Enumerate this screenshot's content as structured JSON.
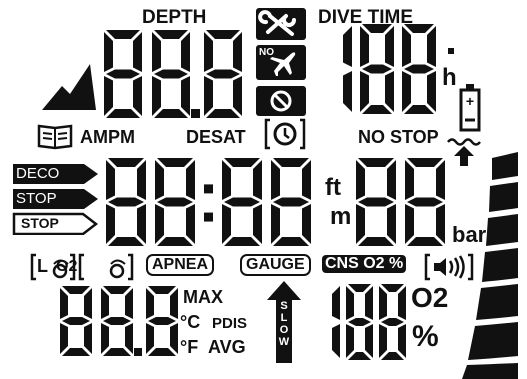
{
  "depth": {
    "label": "DEPTH",
    "value": "88.8"
  },
  "dive_time": {
    "label": "DIVE TIME",
    "value": "188",
    "unit": "h"
  },
  "icons": {
    "no_fly_prefix": "NO",
    "logbook": "logbook-icon",
    "wrench": "wrench-icon",
    "no_fly": "airplane-icon",
    "prohibited": "prohibited-icon",
    "clock": "clock-icon",
    "battery": "battery-icon",
    "mountain": "altitude-icon",
    "ascent_arrow": "ascent-arrow-icon",
    "signal": "signal-icon"
  },
  "time_row": {
    "am_pm": "AMPM",
    "desat": "DESAT",
    "no_stop": "NO STOP"
  },
  "main_display": {
    "value_left": "88",
    "value_mid": "88",
    "value_right": "88",
    "unit_ft": "ft",
    "unit_m": "m",
    "unit_bar": "bar"
  },
  "stop_labels": {
    "deco": "DECO",
    "stop_solid": "STOP",
    "stop_outline": "STOP"
  },
  "mode_row": {
    "l_label": "L",
    "o2_label": "O2",
    "apnea": "APNEA",
    "gauge": "GAUGE",
    "cns_o2_pct": "CNS O2 %"
  },
  "bottom_left": {
    "value": "88.8",
    "max": "MAX",
    "celsius": "°C",
    "pdis": "PDIS",
    "fahrenheit": "°F",
    "avg": "AVG"
  },
  "slow_arrow": {
    "label": "SLOW"
  },
  "bottom_right": {
    "value": "188",
    "o2": "O2",
    "percent": "%"
  }
}
